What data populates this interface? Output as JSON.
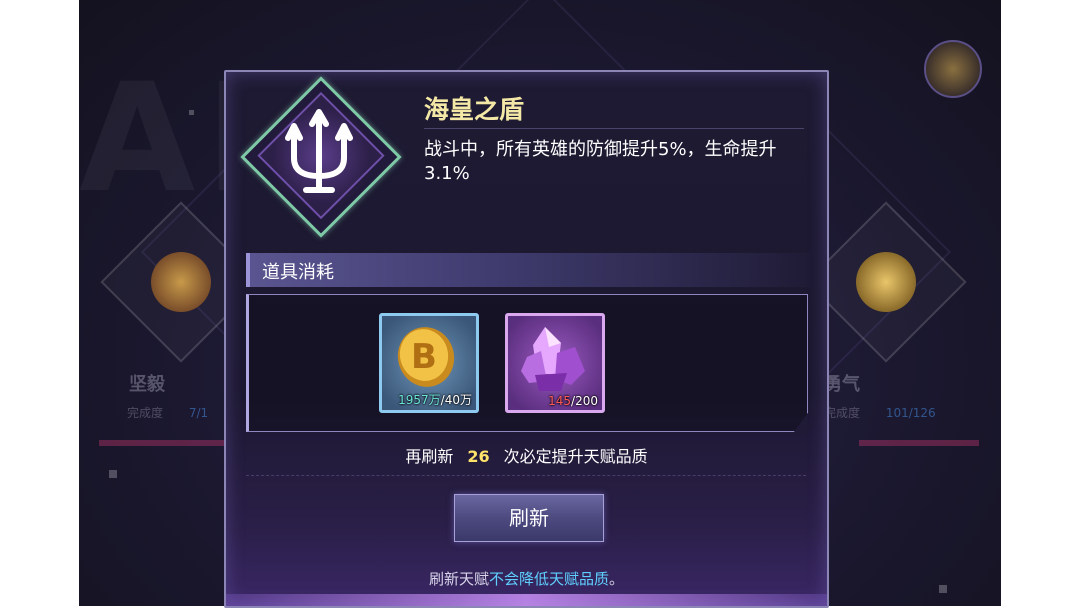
{
  "background": {
    "left_badge_label": "坚毅",
    "left_progress_label": "完成度",
    "left_progress_value": "7/1",
    "right_badge_label": "勇气",
    "right_progress_label": "完成度",
    "right_progress_value": "101/126"
  },
  "dialog": {
    "talent_icon": "trident-icon",
    "title": "海皇之盾",
    "description": "战斗中，所有英雄的防御提升5%，生命提升3.1%",
    "section_title": "道具消耗",
    "items": [
      {
        "name": "gold-coin-icon",
        "have": "1957万",
        "need": "/40万",
        "have_color": "#6be6d8"
      },
      {
        "name": "purple-crystal-icon",
        "have": "145",
        "need": "/200",
        "have_color": "#ff5a5a"
      }
    ],
    "refresh_tip_prefix": "再刷新",
    "refresh_tip_count": "26",
    "refresh_tip_suffix": "次必定提升天赋品质",
    "refresh_button_label": "刷新",
    "footer_note_prefix": "刷新天赋",
    "footer_note_highlight": "不会降低天赋品质",
    "footer_note_suffix": "。"
  },
  "colors": {
    "title": "#f4e8a6",
    "highlight_blue": "#5fd0ff",
    "highlight_yellow": "#ffe36a",
    "frame": "#8c86b6"
  }
}
